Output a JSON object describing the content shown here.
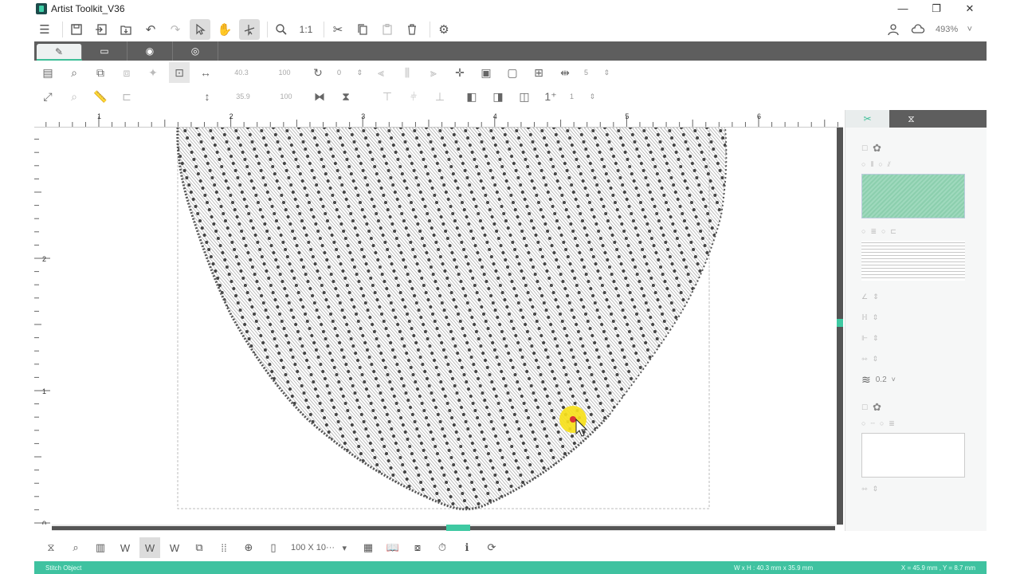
{
  "app": {
    "title": "Artist Toolkit_V36"
  },
  "window_controls": {
    "minimize": "—",
    "maximize": "❐",
    "close": "✕"
  },
  "toolbar": {
    "actual_size_label": "1:1",
    "zoom_value": "493%",
    "zoom_arrow": "˅"
  },
  "property_bar": {
    "width_value": "40.3",
    "width_percent": "100",
    "height_value": "35.9",
    "height_percent": "100",
    "rotation_value": "0",
    "spacing_top": "5",
    "spacing_bottom": "1"
  },
  "ruler": {
    "h_labels": [
      "1",
      "2",
      "3",
      "4",
      "5",
      "6"
    ],
    "v_labels": [
      "2",
      "1",
      "0"
    ]
  },
  "right_panel": {
    "density_value": "0.2"
  },
  "bottom_bar": {
    "hoop_size": "100 X 10···"
  },
  "status": {
    "object_type": "Stitch Object",
    "dimensions": "W x H : 40.3 mm x 35.9 mm",
    "coordinates": "X = 45.9 mm , Y = 8.7 mm"
  },
  "colors": {
    "accent": "#3fc2a0",
    "tab_bar": "#5e5e5e",
    "stitch_point": "#444444",
    "cursor_highlight": "#f7e11b"
  }
}
